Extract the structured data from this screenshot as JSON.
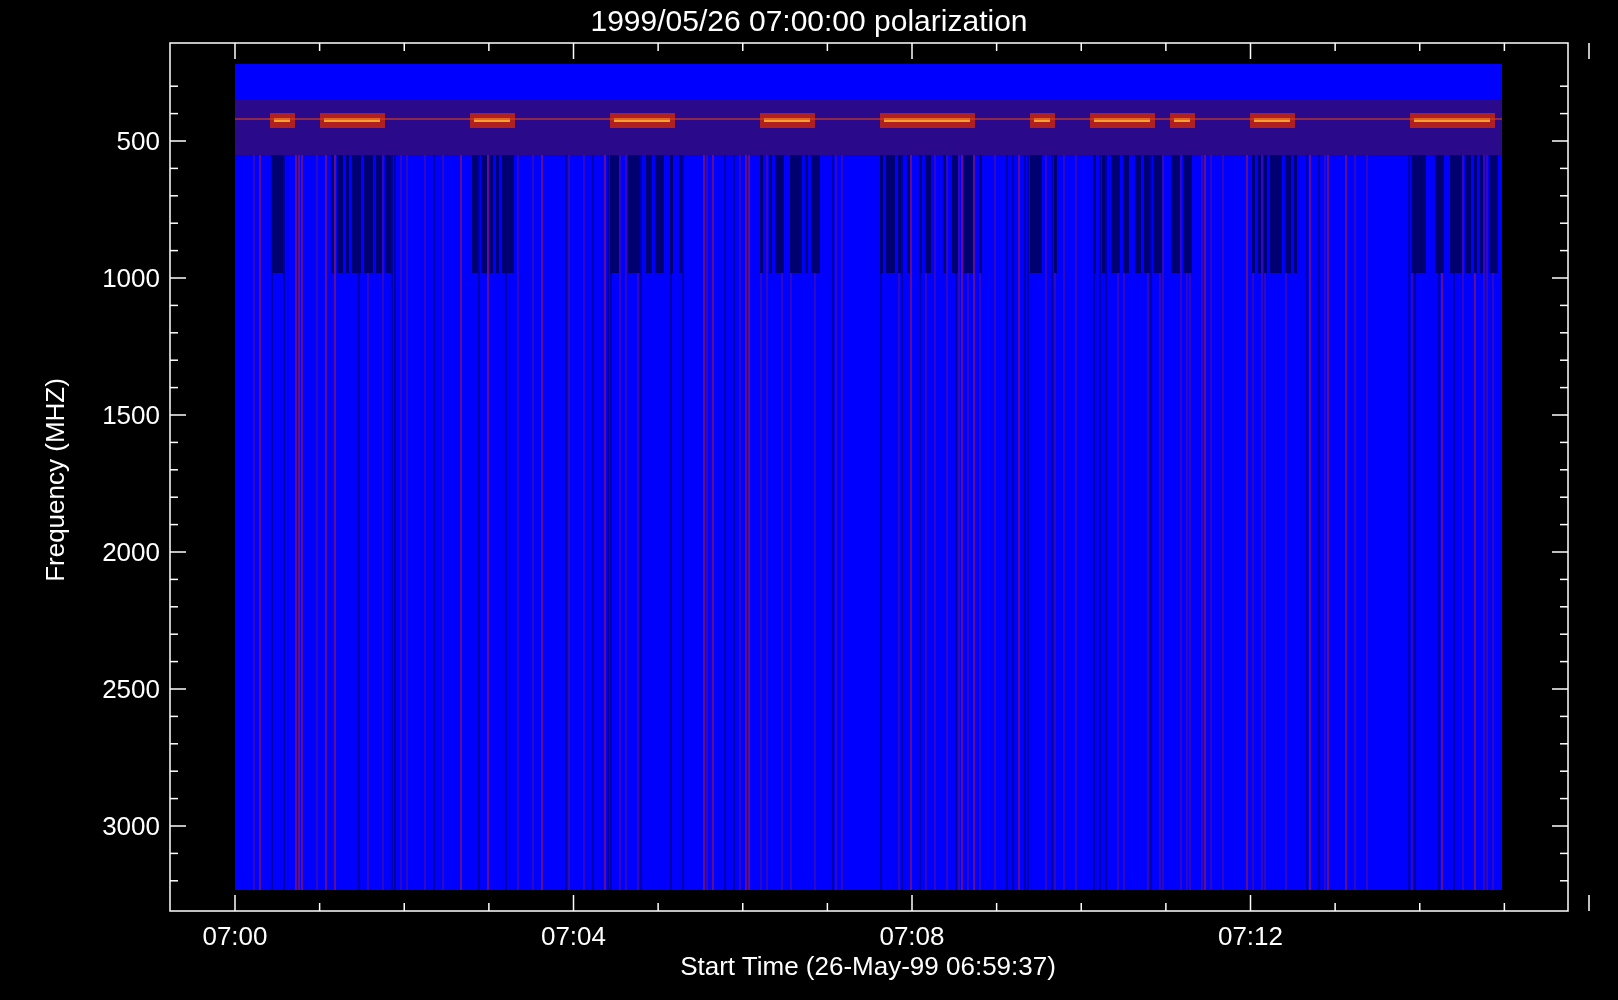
{
  "title": "1999/05/26 07:00:00 polarization",
  "y_axis": {
    "label": "Frequency (MHZ)",
    "ticks": [
      "500",
      "1000",
      "1500",
      "2000",
      "2500",
      "3000"
    ]
  },
  "x_axis": {
    "label": "Start Time (26-May-99 06:59:37)",
    "ticks": [
      "07:00",
      "07:04",
      "07:08",
      "07:12"
    ]
  }
}
